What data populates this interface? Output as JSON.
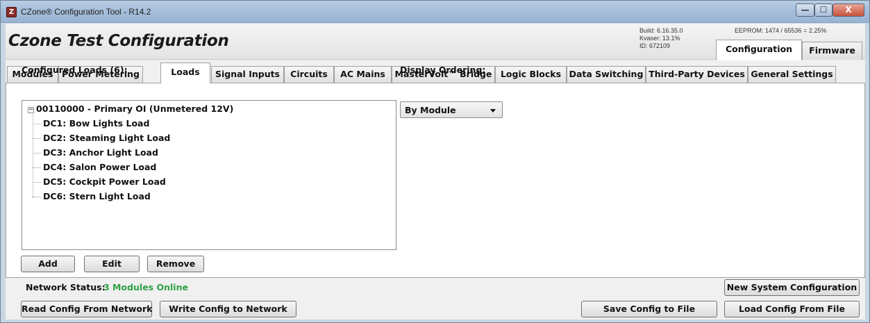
{
  "window": {
    "title": "CZone® Configuration Tool - R14.2",
    "app_icon_glyph": "Z",
    "minimize_glyph": "—",
    "maximize_glyph": "☐",
    "close_glyph": "X"
  },
  "header": {
    "config_name": "Czone Test Configuration",
    "build": "Build: 6.16.35.0",
    "kvaser": "Kvaser: 13.1%",
    "id": "ID: 672109",
    "eeprom": "EEPROM: 1474 / 65536 = 2.25%",
    "top_tabs": [
      {
        "label": "Configuration",
        "active": true
      },
      {
        "label": "Firmware",
        "active": false
      }
    ]
  },
  "tabs": [
    {
      "label": "Modules"
    },
    {
      "label": "Power Metering"
    },
    {
      "label": "Loads",
      "active": true
    },
    {
      "label": "Signal Inputs"
    },
    {
      "label": "Circuits"
    },
    {
      "label": "AC Mains"
    },
    {
      "label": "MasterVolt™ Bridge"
    },
    {
      "label": "Logic Blocks"
    },
    {
      "label": "Data Switching"
    },
    {
      "label": "Third-Party Devices"
    },
    {
      "label": "General Settings"
    }
  ],
  "loads_panel": {
    "configured_label": "Configured Loads (6):",
    "display_ordering_label": "Display Ordering:",
    "display_ordering_value": "By Module",
    "tree": {
      "expander_glyph": "−",
      "root": "00110000 - Primary OI (Unmetered 12V)",
      "items": [
        "DC1: Bow Lights Load",
        "DC2: Steaming Light Load",
        "DC3: Anchor Light Load",
        "DC4: Salon Power Load",
        "DC5: Cockpit Power Load",
        "DC6: Stern Light Load"
      ]
    },
    "buttons": {
      "add": "Add",
      "edit": "Edit",
      "remove": "Remove"
    }
  },
  "footer": {
    "network_status_label": "Network Status:",
    "network_status_value": "3 Modules Online",
    "new_system": "New System Configuration",
    "read_config": "Read Config From Network",
    "write_config": "Write Config to Network",
    "save_config": "Save Config to File",
    "load_config": "Load Config From File"
  },
  "colors": {
    "status_online": "#2ea043",
    "titlebar": "#a7bfdb"
  }
}
